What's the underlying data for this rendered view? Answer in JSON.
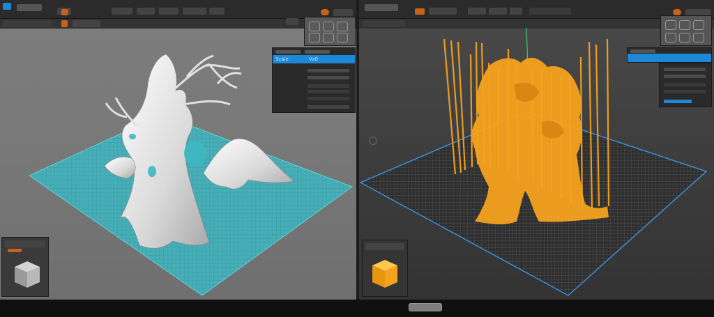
{
  "left_view": {
    "toolbar": {
      "title": "",
      "tabs": [
        "",
        "",
        "",
        "",
        ""
      ]
    },
    "object_panel": {
      "selected_label": "Scale",
      "secondary_label": "Vz0"
    },
    "bed_color": "#3fb7c2",
    "model_color": "#e6e6e6",
    "mini_view_label": ""
  },
  "right_view": {
    "toolbar": {
      "title": "",
      "tabs": [
        "",
        "",
        "",
        ""
      ]
    },
    "object_panel": {
      "selected_label": "",
      "secondary_label": ""
    },
    "bed_color": "#3a8fd8",
    "model_color": "#f5a21e",
    "mini_view_label": ""
  },
  "colors": {
    "accent_orange": "#c8621a",
    "accent_blue": "#1e88d8",
    "panel_bg": "#2a2a2a"
  }
}
